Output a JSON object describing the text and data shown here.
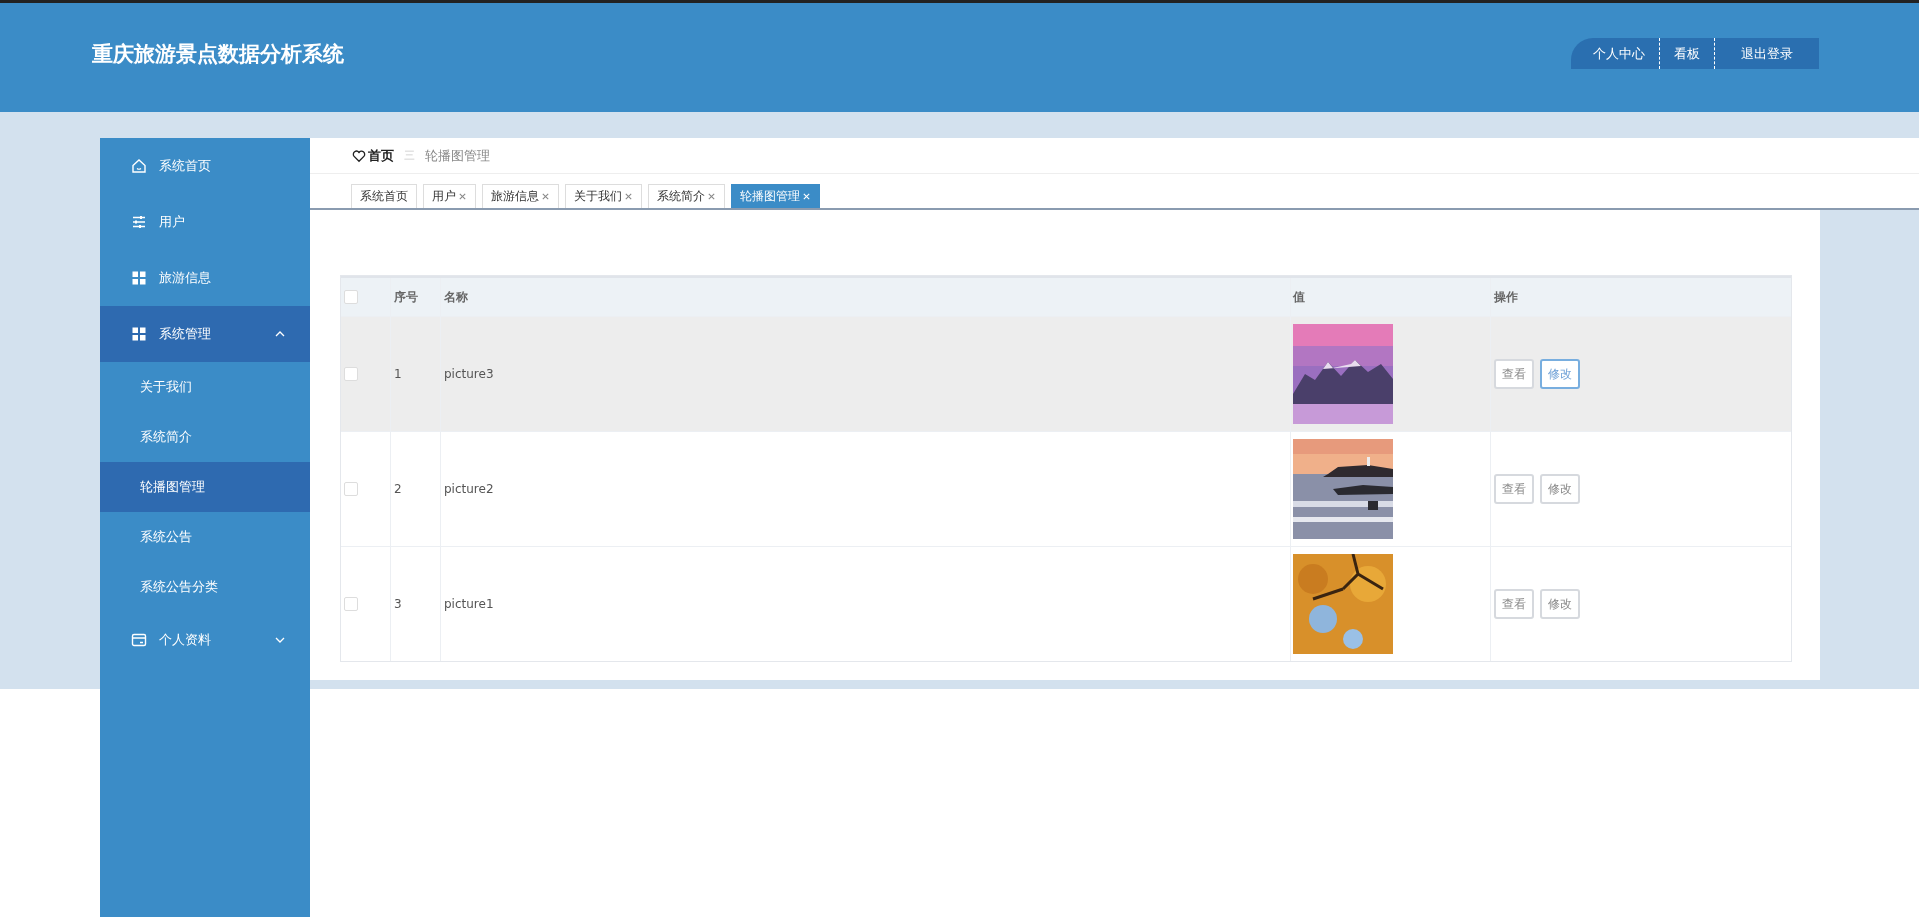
{
  "header": {
    "title": "重庆旅游景点数据分析系统",
    "nav": [
      {
        "label": "个人中心"
      },
      {
        "label": "看板"
      },
      {
        "label": "退出登录"
      }
    ]
  },
  "sidebar": {
    "items": [
      {
        "label": "系统首页",
        "selected": false
      },
      {
        "label": "用户",
        "selected": false
      },
      {
        "label": "旅游信息",
        "selected": false
      },
      {
        "label": "系统管理",
        "selected": true,
        "expanded": true,
        "children": [
          {
            "label": "关于我们",
            "selected": false
          },
          {
            "label": "系统简介",
            "selected": false
          },
          {
            "label": "轮播图管理",
            "selected": true
          },
          {
            "label": "系统公告",
            "selected": false
          },
          {
            "label": "系统公告分类",
            "selected": false
          }
        ]
      },
      {
        "label": "个人资料",
        "selected": false,
        "expanded": false
      }
    ]
  },
  "breadcrumb": {
    "home": "首页",
    "separator": "三",
    "current": "轮播图管理"
  },
  "tabs": [
    {
      "label": "系统首页",
      "closable": false,
      "selected": false
    },
    {
      "label": "用户",
      "closable": true,
      "selected": false
    },
    {
      "label": "旅游信息",
      "closable": true,
      "selected": false
    },
    {
      "label": "关于我们",
      "closable": true,
      "selected": false
    },
    {
      "label": "系统简介",
      "closable": true,
      "selected": false
    },
    {
      "label": "轮播图管理",
      "closable": true,
      "selected": true
    }
  ],
  "table": {
    "columns": [
      "序号",
      "名称",
      "值",
      "操作"
    ],
    "header_checked": false,
    "rows": [
      {
        "index": "1",
        "name": "picture3",
        "checked": false,
        "hovered": true,
        "actions": [
          {
            "label": "查看",
            "hovered": false
          },
          {
            "label": "修改",
            "hovered": true
          }
        ]
      },
      {
        "index": "2",
        "name": "picture2",
        "checked": false,
        "hovered": false,
        "actions": [
          {
            "label": "查看",
            "hovered": false
          },
          {
            "label": "修改",
            "hovered": false
          }
        ]
      },
      {
        "index": "3",
        "name": "picture1",
        "checked": false,
        "hovered": false,
        "actions": [
          {
            "label": "查看",
            "hovered": false
          },
          {
            "label": "修改",
            "hovered": false
          }
        ]
      }
    ]
  }
}
